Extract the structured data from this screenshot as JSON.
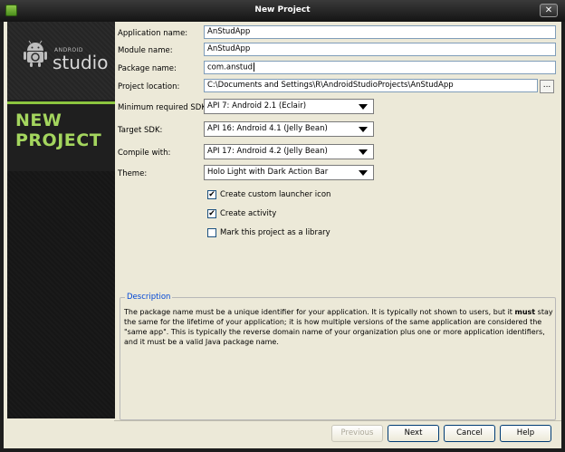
{
  "window": {
    "title": "New Project",
    "close_label": "✕"
  },
  "sidebar": {
    "logo_small": "ANDROID",
    "logo_text": "studio",
    "heading_line1": "NEW",
    "heading_line2": "PROJECT"
  },
  "form": {
    "application_name": {
      "label": "Application name:",
      "value": "AnStudApp"
    },
    "module_name": {
      "label": "Module name:",
      "value": "AnStudApp"
    },
    "package_name": {
      "label": "Package name:",
      "value": "com.anstud"
    },
    "project_location": {
      "label": "Project location:",
      "value": "C:\\Documents and Settings\\R\\AndroidStudioProjects\\AnStudApp",
      "browse_label": "..."
    },
    "min_sdk": {
      "label": "Minimum required SDK:",
      "value": "API 7: Android 2.1 (Eclair)"
    },
    "target_sdk": {
      "label": "Target SDK:",
      "value": "API 16: Android 4.1 (Jelly Bean)"
    },
    "compile_with": {
      "label": "Compile with:",
      "value": "API 17: Android 4.2 (Jelly Bean)"
    },
    "theme": {
      "label": "Theme:",
      "value": "Holo Light with Dark Action Bar"
    }
  },
  "options": [
    {
      "label": "Create custom launcher icon",
      "checked": true,
      "mark": "✔"
    },
    {
      "label": "Create activity",
      "checked": true,
      "mark": "✔"
    },
    {
      "label": "Mark this project as a library",
      "checked": false,
      "mark": ""
    }
  ],
  "description": {
    "title": "Description",
    "before_bold": "The package name must be a unique identifier for your application. It is typically not shown to users, but it ",
    "bold": "must",
    "after_bold": " stay the same for the lifetime of your application; it is how multiple versions of the same application are considered the \"same app\". This is typically the reverse domain name of your organization plus one or more application identifiers, and it must be a valid Java package name."
  },
  "buttons": {
    "previous": "Previous",
    "next": "Next",
    "cancel": "Cancel",
    "help": "Help"
  }
}
